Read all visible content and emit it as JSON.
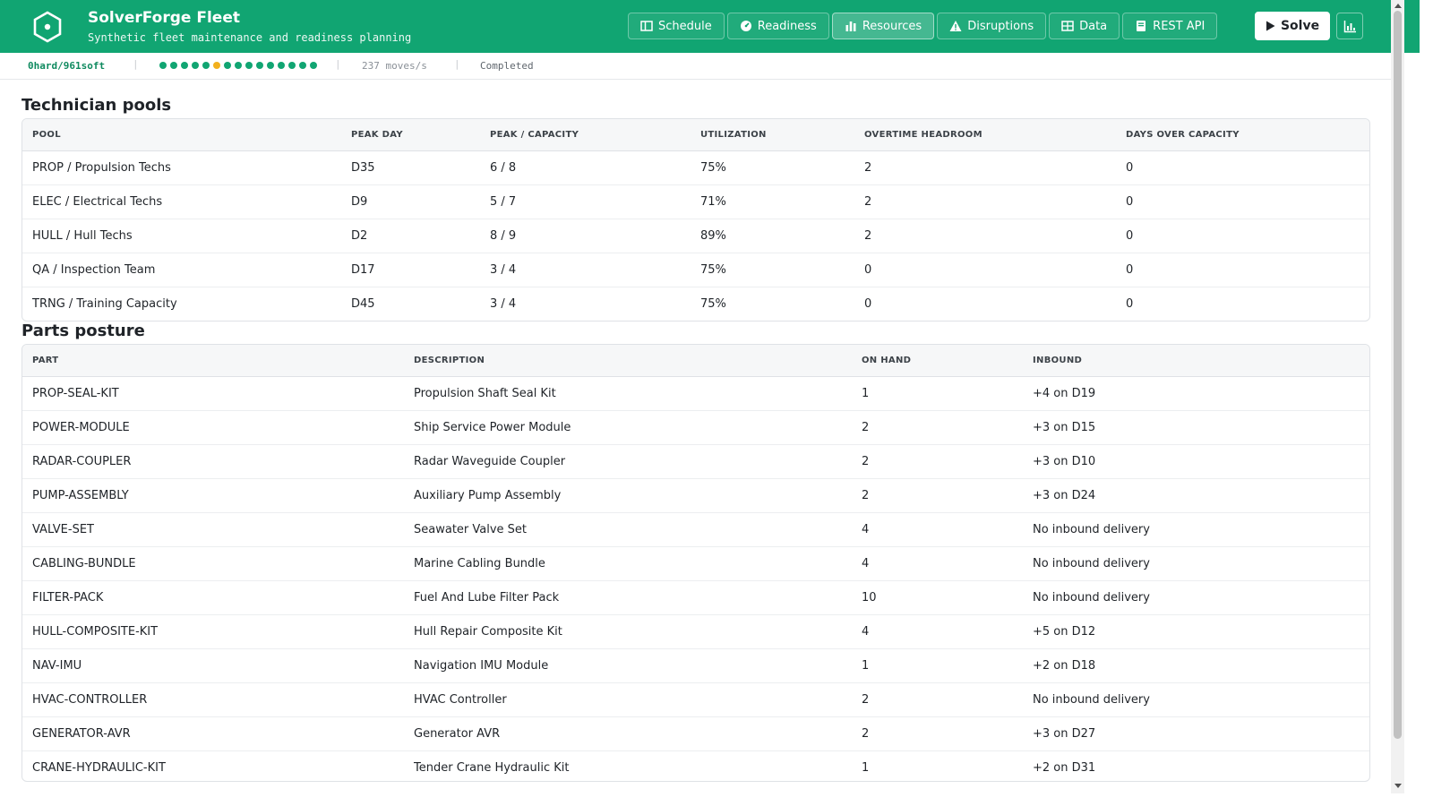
{
  "app": {
    "title": "SolverForge Fleet",
    "subtitle": "Synthetic fleet maintenance and readiness planning"
  },
  "nav": [
    {
      "label": "Schedule",
      "icon": "schedule-icon",
      "active": false
    },
    {
      "label": "Readiness",
      "icon": "gauge-icon",
      "active": false
    },
    {
      "label": "Resources",
      "icon": "bar-chart-icon",
      "active": true
    },
    {
      "label": "Disruptions",
      "icon": "warning-icon",
      "active": false
    },
    {
      "label": "Data",
      "icon": "table-icon",
      "active": false
    },
    {
      "label": "REST API",
      "icon": "book-icon",
      "active": false
    }
  ],
  "actions": {
    "solve_label": "Solve",
    "analysis_icon": "line-chart-icon"
  },
  "status": {
    "score": "0hard/961soft",
    "dots": [
      "ok",
      "ok",
      "ok",
      "ok",
      "ok",
      "warn",
      "ok",
      "ok",
      "ok",
      "ok",
      "ok",
      "ok",
      "ok",
      "ok",
      "ok"
    ],
    "speed": "237 moves/s",
    "state": "Completed"
  },
  "technician_pools": {
    "title": "Technician pools",
    "columns": [
      "POOL",
      "PEAK DAY",
      "PEAK / CAPACITY",
      "UTILIZATION",
      "OVERTIME HEADROOM",
      "DAYS OVER CAPACITY"
    ],
    "rows": [
      [
        "PROP / Propulsion Techs",
        "D35",
        "6 / 8",
        "75%",
        "2",
        "0"
      ],
      [
        "ELEC / Electrical Techs",
        "D9",
        "5 / 7",
        "71%",
        "2",
        "0"
      ],
      [
        "HULL / Hull Techs",
        "D2",
        "8 / 9",
        "89%",
        "2",
        "0"
      ],
      [
        "QA / Inspection Team",
        "D17",
        "3 / 4",
        "75%",
        "0",
        "0"
      ],
      [
        "TRNG / Training Capacity",
        "D45",
        "3 / 4",
        "75%",
        "0",
        "0"
      ]
    ]
  },
  "parts_posture": {
    "title": "Parts posture",
    "columns": [
      "PART",
      "DESCRIPTION",
      "ON HAND",
      "INBOUND"
    ],
    "rows": [
      [
        "PROP-SEAL-KIT",
        "Propulsion Shaft Seal Kit",
        "1",
        "+4 on D19"
      ],
      [
        "POWER-MODULE",
        "Ship Service Power Module",
        "2",
        "+3 on D15"
      ],
      [
        "RADAR-COUPLER",
        "Radar Waveguide Coupler",
        "2",
        "+3 on D10"
      ],
      [
        "PUMP-ASSEMBLY",
        "Auxiliary Pump Assembly",
        "2",
        "+3 on D24"
      ],
      [
        "VALVE-SET",
        "Seawater Valve Set",
        "4",
        "No inbound delivery"
      ],
      [
        "CABLING-BUNDLE",
        "Marine Cabling Bundle",
        "4",
        "No inbound delivery"
      ],
      [
        "FILTER-PACK",
        "Fuel And Lube Filter Pack",
        "10",
        "No inbound delivery"
      ],
      [
        "HULL-COMPOSITE-KIT",
        "Hull Repair Composite Kit",
        "4",
        "+5 on D12"
      ],
      [
        "NAV-IMU",
        "Navigation IMU Module",
        "1",
        "+2 on D18"
      ],
      [
        "HVAC-CONTROLLER",
        "HVAC Controller",
        "2",
        "No inbound delivery"
      ],
      [
        "GENERATOR-AVR",
        "Generator AVR",
        "2",
        "+3 on D27"
      ],
      [
        "CRANE-HYDRAULIC-KIT",
        "Tender Crane Hydraulic Kit",
        "1",
        "+2 on D31"
      ]
    ]
  },
  "colors": {
    "brand": "#11a572",
    "ok_dot": "#11a572",
    "warn_dot": "#f2b01e"
  }
}
